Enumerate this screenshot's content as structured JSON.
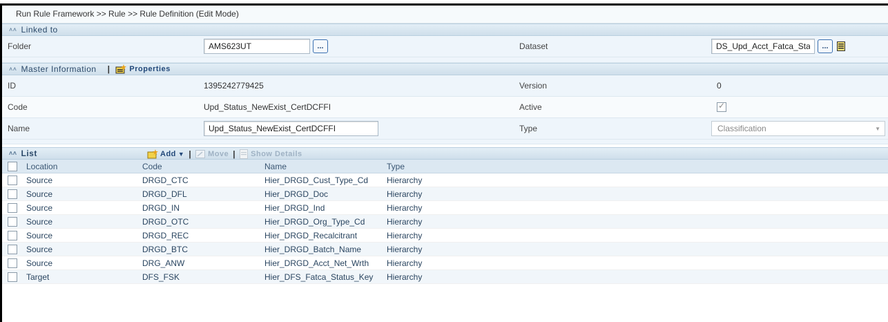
{
  "breadcrumb": "Run Rule Framework >> Rule >> Rule Definition (Edit Mode)",
  "linked": {
    "header": "Linked to",
    "folder_label": "Folder",
    "folder_value": "AMS623UT",
    "dataset_label": "Dataset",
    "dataset_value": "DS_Upd_Acct_Fatca_Stat",
    "browse_label": "..."
  },
  "master": {
    "header": "Master Information",
    "properties_label": "Properties",
    "id_label": "ID",
    "id_value": "1395242779425",
    "version_label": "Version",
    "version_value": "0",
    "code_label": "Code",
    "code_value": "Upd_Status_NewExist_CertDCFFI",
    "active_label": "Active",
    "name_label": "Name",
    "name_value": "Upd_Status_NewExist_CertDCFFI",
    "type_label": "Type",
    "type_value": "Classification"
  },
  "list": {
    "header": "List",
    "add_label": "Add",
    "move_label": "Move",
    "show_details_label": "Show Details",
    "columns": [
      "Location",
      "Code",
      "Name",
      "Type"
    ],
    "rows": [
      {
        "location": "Source",
        "code": "DRGD_CTC",
        "name": "Hier_DRGD_Cust_Type_Cd",
        "type": "Hierarchy"
      },
      {
        "location": "Source",
        "code": "DRGD_DFL",
        "name": "Hier_DRGD_Doc",
        "type": "Hierarchy"
      },
      {
        "location": "Source",
        "code": "DRGD_IN",
        "name": "Hier_DRGD_Ind",
        "type": "Hierarchy"
      },
      {
        "location": "Source",
        "code": "DRGD_OTC",
        "name": "Hier_DRGD_Org_Type_Cd",
        "type": "Hierarchy"
      },
      {
        "location": "Source",
        "code": "DRGD_REC",
        "name": "Hier_DRGD_Recalcitrant",
        "type": "Hierarchy"
      },
      {
        "location": "Source",
        "code": "DRGD_BTC",
        "name": "Hier_DRGD_Batch_Name",
        "type": "Hierarchy"
      },
      {
        "location": "Source",
        "code": "DRG_ANW",
        "name": "Hier_DRGD_Acct_Net_Wrth",
        "type": "Hierarchy"
      },
      {
        "location": "Target",
        "code": "DFS_FSK",
        "name": "Hier_DFS_Fatca_Status_Key",
        "type": "Hierarchy"
      }
    ]
  },
  "icons": {
    "collapse": "double-chevron-up-icon",
    "properties": "properties-icon",
    "add": "add-folder-icon",
    "move": "move-icon",
    "show_details": "details-icon",
    "dataset_view": "view-document-icon"
  },
  "colors": {
    "header_bg": "#dce8f2",
    "accent": "#23497a"
  }
}
